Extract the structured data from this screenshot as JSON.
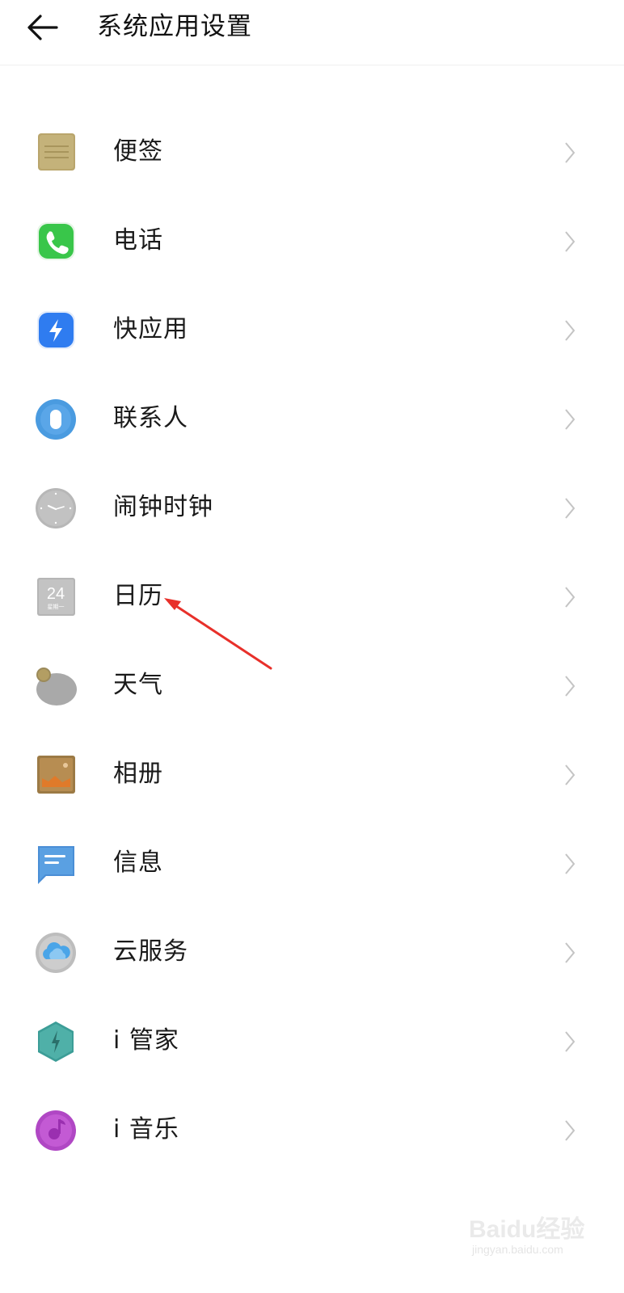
{
  "header": {
    "title": "系统应用设置",
    "back_icon": "back-arrow-icon"
  },
  "apps": [
    {
      "label": "便签",
      "icon": "notes-icon"
    },
    {
      "label": "电话",
      "icon": "phone-icon"
    },
    {
      "label": "快应用",
      "icon": "quick-app-icon"
    },
    {
      "label": "联系人",
      "icon": "contacts-icon"
    },
    {
      "label": "闹钟时钟",
      "icon": "clock-icon"
    },
    {
      "label": "日历",
      "icon": "calendar-icon",
      "icon_day": "24",
      "icon_weekday": "星期一"
    },
    {
      "label": "天气",
      "icon": "weather-icon"
    },
    {
      "label": "相册",
      "icon": "gallery-icon"
    },
    {
      "label": "信息",
      "icon": "messages-icon"
    },
    {
      "label": "云服务",
      "icon": "cloud-service-icon"
    },
    {
      "label": "i 管家",
      "icon": "i-manager-icon"
    },
    {
      "label": "i 音乐",
      "icon": "i-music-icon"
    }
  ],
  "watermark": {
    "main": "Baidu经验",
    "sub": "jingyan.baidu.com"
  },
  "colors": {
    "annotation_arrow": "#e8302a",
    "chevron": "#c4c4c4",
    "divider": "#f0f0f0"
  }
}
